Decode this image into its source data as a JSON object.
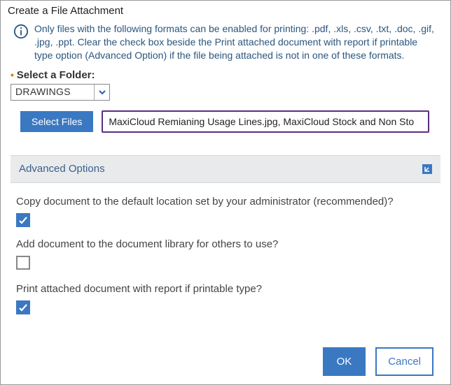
{
  "dialog": {
    "title": "Create a File Attachment",
    "info_text": "Only files with the following formats can be enabled for printing: .pdf, .xls, .csv, .txt, .doc, .gif, .jpg, .ppt. Clear the check box beside the Print attached document with report if printable type option (Advanced Option) if the file being attached is not in one of these formats."
  },
  "folder": {
    "label": "Select a Folder:",
    "value": "DRAWINGS"
  },
  "files": {
    "button_label": "Select Files",
    "value": "MaxiCloud Remianing Usage Lines.jpg,  MaxiCloud Stock and Non Sto"
  },
  "advanced": {
    "title": "Advanced Options"
  },
  "options": {
    "copy_label": "Copy document to the default location set by your administrator (recommended)?",
    "copy_checked": true,
    "library_label": "Add document to the document library for others to use?",
    "library_checked": false,
    "print_label": "Print attached document with report if printable type?",
    "print_checked": true
  },
  "footer": {
    "ok": "OK",
    "cancel": "Cancel"
  }
}
